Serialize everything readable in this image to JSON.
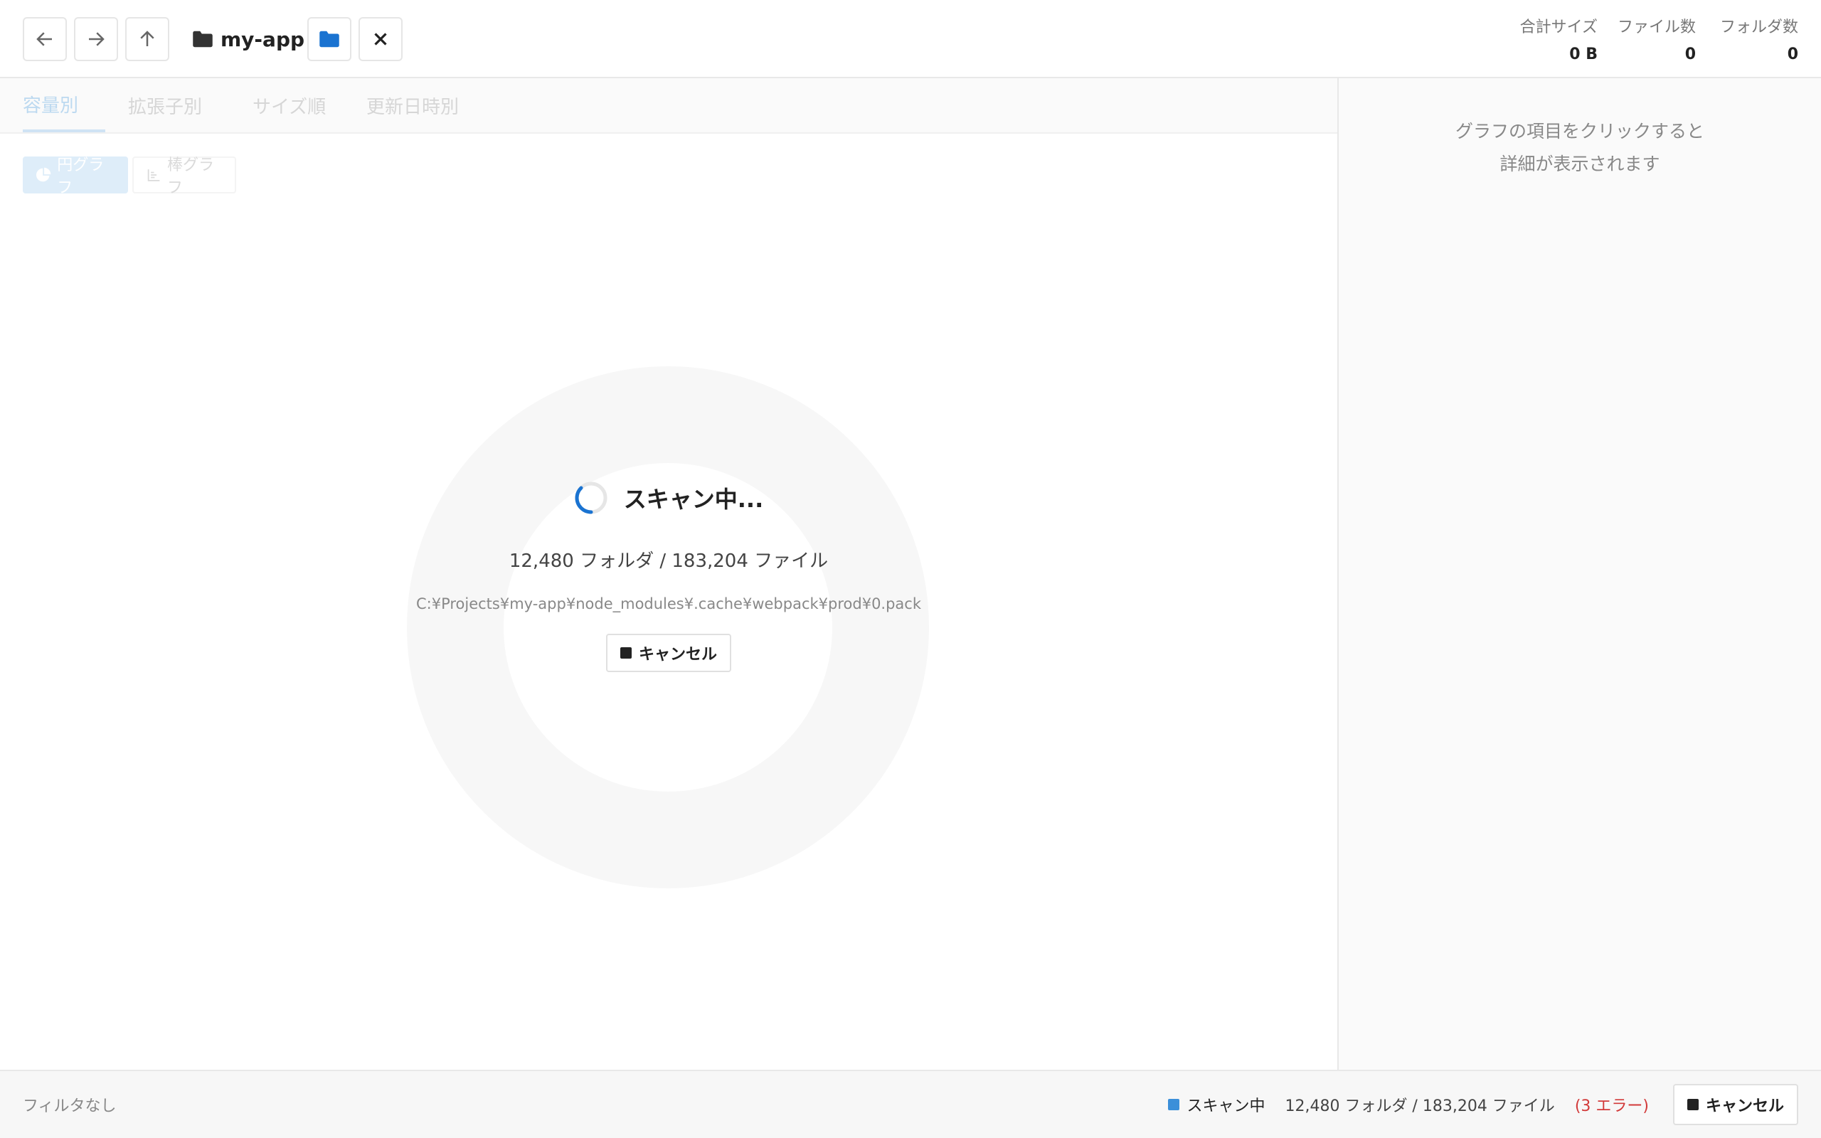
{
  "header": {
    "path_label": "my-app",
    "stats": [
      {
        "key": "合計サイズ",
        "value": "0 B"
      },
      {
        "key": "ファイル数",
        "value": "0"
      },
      {
        "key": "フォルダ数",
        "value": "0"
      }
    ]
  },
  "tabs": [
    {
      "label": "容量別",
      "active": true
    },
    {
      "label": "拡張子別",
      "active": false
    },
    {
      "label": "サイズ順",
      "active": false
    },
    {
      "label": "更新日時別",
      "active": false
    }
  ],
  "chart_toggle": {
    "pie_label": "円グラフ",
    "bar_label": "棒グラフ"
  },
  "scan": {
    "title": "スキャン中...",
    "counts": "12,480 フォルダ / 183,204 ファイル",
    "current_path": "C:¥Projects¥my-app¥node_modules¥.cache¥webpack¥prod¥0.pack",
    "cancel_label": "キャンセル"
  },
  "side": {
    "hint_line1": "グラフの項目をクリックすると",
    "hint_line2": "詳細が表示されます"
  },
  "statusbar": {
    "filter": "フィルタなし",
    "status": "スキャン中",
    "counts": "12,480 フォルダ / 183,204 ファイル",
    "errors": "(3 エラー)",
    "cancel_label": "キャンセル"
  },
  "colors": {
    "accent": "#1a73d1",
    "error": "#d23a3a",
    "status_dot": "#3b8fd9"
  },
  "icons": [
    "arrow-left-icon",
    "arrow-right-icon",
    "arrow-up-icon",
    "folder-icon",
    "folder-open-icon",
    "close-icon",
    "pie-chart-icon",
    "bar-chart-icon",
    "spinner-icon",
    "stop-icon"
  ]
}
